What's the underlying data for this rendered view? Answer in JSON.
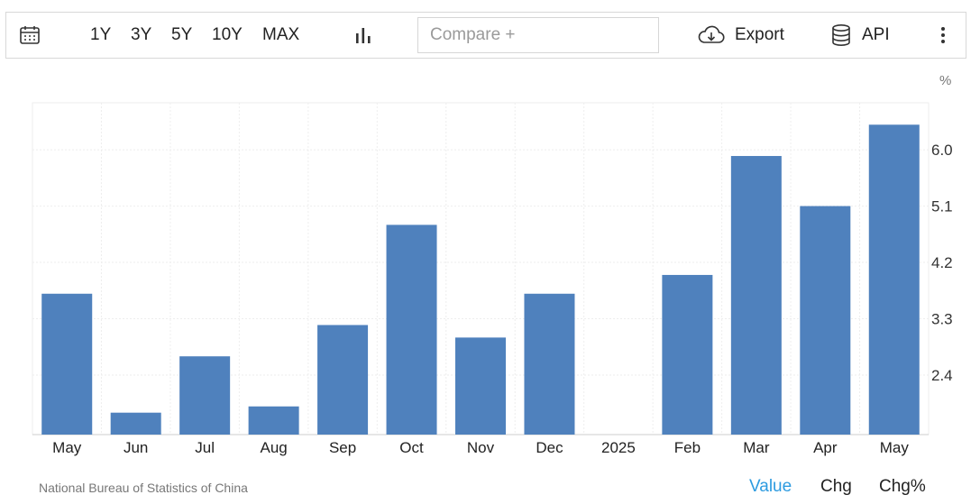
{
  "toolbar": {
    "icons": {
      "calendar": "calendar-icon",
      "chart_type": "bar-chart-icon",
      "export": "cloud-download-icon",
      "api": "database-icon",
      "more": "vertical-dots-icon"
    },
    "ranges": [
      "1Y",
      "3Y",
      "5Y",
      "10Y",
      "MAX"
    ],
    "compare_placeholder": "Compare +",
    "export_label": "Export",
    "api_label": "API"
  },
  "chart_data": {
    "type": "bar",
    "title": "",
    "categories": [
      "May",
      "Jun",
      "Jul",
      "Aug",
      "Sep",
      "Oct",
      "Nov",
      "Dec",
      "2025",
      "Feb",
      "Mar",
      "Apr",
      "May"
    ],
    "values": [
      3.7,
      1.8,
      2.7,
      1.9,
      3.2,
      4.8,
      3.0,
      3.7,
      null,
      4.0,
      5.9,
      5.1,
      6.4
    ],
    "unit": "%",
    "ylim": [
      1.45,
      6.75
    ],
    "yticks": [
      "2.4",
      "3.3",
      "4.2",
      "5.1",
      "6.0"
    ],
    "xlabel": "",
    "ylabel": "",
    "grid": true,
    "bar_color": "#4f81bd"
  },
  "footer": {
    "source": "National Bureau of Statistics of China",
    "tabs": [
      "Value",
      "Chg",
      "Chg%"
    ],
    "active_tab": "Value",
    "active_color": "#2d9be0"
  }
}
